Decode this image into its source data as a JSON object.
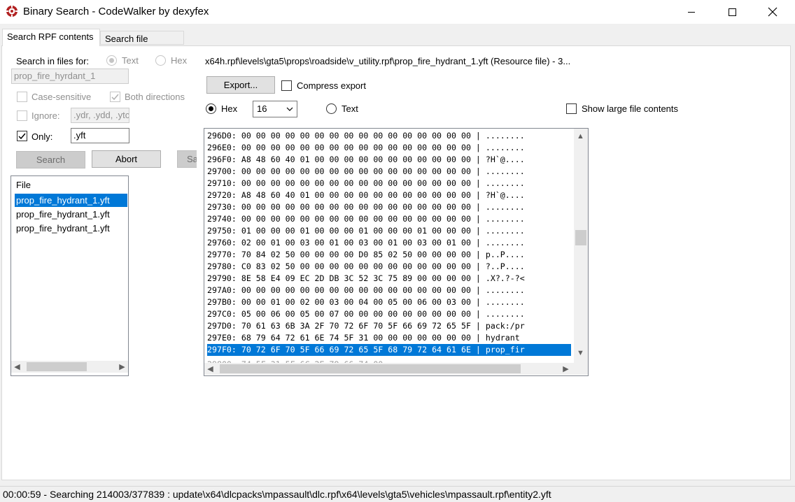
{
  "window": {
    "title": "Binary Search - CodeWalker by dexyfex"
  },
  "tabs": [
    {
      "label": "Search RPF contents"
    },
    {
      "label": "Search file system"
    }
  ],
  "search": {
    "search_in_label": "Search in files for:",
    "mode_text_label": "Text",
    "mode_hex_label": "Hex",
    "query_value": "prop_fire_hyrdant_1",
    "case_sensitive_label": "Case-sensitive",
    "both_directions_label": "Both directions",
    "ignore_label": "Ignore:",
    "ignore_value": ".ydr, .ydd, .ytc",
    "only_label": "Only:",
    "only_value": ".yft",
    "search_button": "Search",
    "abort_button": "Abort",
    "save_button_partial": "Sa"
  },
  "results": {
    "header": "File",
    "items": [
      "prop_fire_hydrant_1.yft",
      "prop_fire_hydrant_1.yft",
      "prop_fire_hydrant_1.yft"
    ]
  },
  "viewer": {
    "path": "x64h.rpf\\levels\\gta5\\props\\roadside\\v_utility.rpf\\prop_fire_hydrant_1.yft (Resource file)  -  3...",
    "export_button": "Export...",
    "compress_label": "Compress export",
    "hex_label": "Hex",
    "width_value": "16",
    "text_label": "Text",
    "show_large_label": "Show large file contents",
    "lines": [
      "296D0: 00 00 00 00 00 00 00 00 00 00 00 00 00 00 00 00 | ........",
      "296E0: 00 00 00 00 00 00 00 00 00 00 00 00 00 00 00 00 | ........",
      "296F0: A8 48 60 40 01 00 00 00 00 00 00 00 00 00 00 00 | ?H`@....",
      "29700: 00 00 00 00 00 00 00 00 00 00 00 00 00 00 00 00 | ........",
      "29710: 00 00 00 00 00 00 00 00 00 00 00 00 00 00 00 00 | ........",
      "29720: A8 48 60 40 01 00 00 00 00 00 00 00 00 00 00 00 | ?H`@....",
      "29730: 00 00 00 00 00 00 00 00 00 00 00 00 00 00 00 00 | ........",
      "29740: 00 00 00 00 00 00 00 00 00 00 00 00 00 00 00 00 | ........",
      "29750: 01 00 00 00 01 00 00 00 01 00 00 00 01 00 00 00 | ........",
      "29760: 02 00 01 00 03 00 01 00 03 00 01 00 03 00 01 00 | ........",
      "29770: 70 84 02 50 00 00 00 00 D0 85 02 50 00 00 00 00 | p..P....",
      "29780: C0 83 02 50 00 00 00 00 00 00 00 00 00 00 00 00 | ?..P....",
      "29790: 8E 58 E4 09 EC 2D DB 3C 52 3C 75 89 00 00 00 00 | .X?.?-?<",
      "297A0: 00 00 00 00 00 00 00 00 00 00 00 00 00 00 00 00 | ........",
      "297B0: 00 00 01 00 02 00 03 00 04 00 05 00 06 00 03 00 | ........",
      "297C0: 05 00 06 00 05 00 07 00 00 00 00 00 00 00 00 00 | ........",
      "297D0: 70 61 63 6B 3A 2F 70 72 6F 70 5F 66 69 72 65 5F | pack:/pr",
      "297E0: 68 79 64 72 61 6E 74 5F 31 00 00 00 00 00 00 00 | hydrant ",
      "297F0: 70 72 6F 70 5F 66 69 72 65 5F 68 79 72 64 61 6E | prop_fir"
    ],
    "selected_line_index": 18
  },
  "status": {
    "text": "00:00:59 - Searching 214003/377839 : update\\x64\\dlcpacks\\mpassault\\dlc.rpf\\x64\\levels\\gta5\\vehicles\\mpassault.rpf\\entity2.yft"
  }
}
